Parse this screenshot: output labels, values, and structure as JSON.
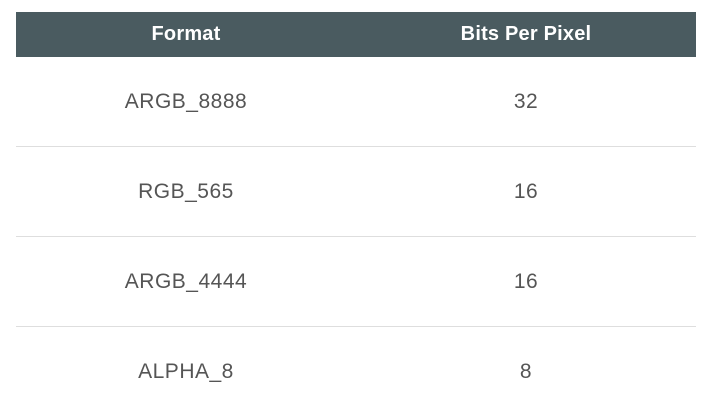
{
  "table": {
    "headers": [
      "Format",
      "Bits Per Pixel"
    ],
    "rows": [
      {
        "format": "ARGB_8888",
        "bits": "32"
      },
      {
        "format": "RGB_565",
        "bits": "16"
      },
      {
        "format": "ARGB_4444",
        "bits": "16"
      },
      {
        "format": "ALPHA_8",
        "bits": "8"
      }
    ]
  },
  "colors": {
    "header_background": "#4a5b60",
    "header_text": "#ffffff",
    "cell_text": "#555555",
    "divider": "#dedede"
  }
}
